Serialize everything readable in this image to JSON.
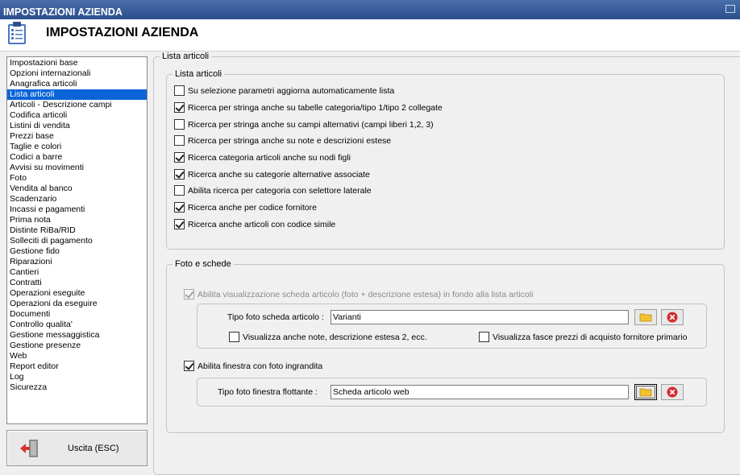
{
  "window": {
    "title": "IMPOSTAZIONI AZIENDA"
  },
  "header": {
    "title": "IMPOSTAZIONI AZIENDA",
    "icon": "checklist-icon"
  },
  "sidebar": {
    "items": [
      {
        "label": "Impostazioni base"
      },
      {
        "label": "Opzioni internazionali"
      },
      {
        "label": "Anagrafica articoli"
      },
      {
        "label": "Lista articoli"
      },
      {
        "label": "Articoli - Descrizione campi"
      },
      {
        "label": "Codifica articoli"
      },
      {
        "label": "Listini di vendita"
      },
      {
        "label": "Prezzi base"
      },
      {
        "label": "Taglie e colori"
      },
      {
        "label": "Codici a barre"
      },
      {
        "label": "Avvisi su movimenti"
      },
      {
        "label": "Foto"
      },
      {
        "label": "Vendita al banco"
      },
      {
        "label": "Scadenzario"
      },
      {
        "label": "Incassi e pagamenti"
      },
      {
        "label": "Prima nota"
      },
      {
        "label": "Distinte RiBa/RID"
      },
      {
        "label": "Solleciti di pagamento"
      },
      {
        "label": "Gestione fido"
      },
      {
        "label": "Riparazioni"
      },
      {
        "label": "Cantieri"
      },
      {
        "label": "Contratti"
      },
      {
        "label": "Operazioni eseguite"
      },
      {
        "label": "Operazioni da eseguire"
      },
      {
        "label": "Documenti"
      },
      {
        "label": "Controllo qualita'"
      },
      {
        "label": "Gestione messaggistica"
      },
      {
        "label": "Gestione presenze"
      },
      {
        "label": "Web"
      },
      {
        "label": "Report editor"
      },
      {
        "label": "Log"
      },
      {
        "label": "Sicurezza"
      }
    ],
    "selected": "Lista articoli"
  },
  "exit_button": {
    "label": "Uscita (ESC)",
    "icon": "exit-door-icon"
  },
  "main": {
    "outer_legend": "Lista articoli",
    "list_group": {
      "legend": "Lista articoli",
      "options": [
        {
          "label": "Su selezione parametri aggiorna automaticamente lista",
          "checked": false
        },
        {
          "label": "Ricerca per stringa anche su tabelle categoria/tipo 1/tipo 2 collegate",
          "checked": true
        },
        {
          "label": "Ricerca per stringa anche su campi alternativi (campi liberi 1,2, 3)",
          "checked": false
        },
        {
          "label": "Ricerca per stringa anche su note e descrizioni estese",
          "checked": false
        },
        {
          "label": "Ricerca categoria articoli anche su nodi figli",
          "checked": true
        },
        {
          "label": "Ricerca anche su categorie alternative associate",
          "checked": true
        },
        {
          "label": "Abilita ricerca per categoria con selettore laterale",
          "checked": false
        },
        {
          "label": "Ricerca anche per codice fornitore",
          "checked": true
        },
        {
          "label": "Ricerca anche articoli con codice simile",
          "checked": true
        }
      ]
    },
    "photo_group": {
      "legend": "Foto e schede",
      "enable_sheet": {
        "label": "Abilita visualizzazione scheda articolo (foto + descrizione estesa) in fondo alla lista articoli",
        "checked": true,
        "disabled": true
      },
      "sheet_photo_type": {
        "label": "Tipo foto scheda articolo :",
        "value": "Varianti"
      },
      "show_notes": {
        "label": "Visualizza anche note, descrizione estesa 2, ecc.",
        "checked": false
      },
      "show_price_bands": {
        "label": "Visualizza fasce prezzi di acquisto fornitore primario",
        "checked": false
      },
      "enable_window": {
        "label": "Abilita finestra con foto ingrandita",
        "checked": true
      },
      "window_photo_type": {
        "label": "Tipo foto finestra flottante :",
        "value": "Scheda articolo web"
      }
    }
  },
  "colors": {
    "selection": "#0a64d8",
    "titlebar": "#2a4f8e",
    "delete_red": "#d42a2a",
    "folder_yellow": "#f2c230"
  }
}
